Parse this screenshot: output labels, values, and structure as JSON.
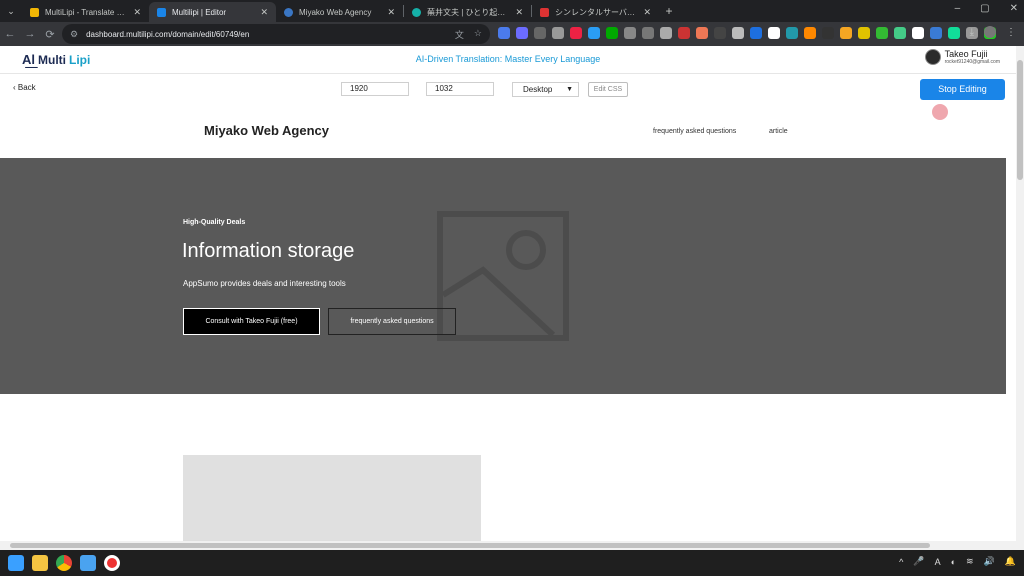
{
  "browser": {
    "tabs": [
      {
        "title": "MultiLipi - Translate websites h",
        "favicon_color": "#f2b705",
        "active": false
      },
      {
        "title": "Multilipi | Editor",
        "favicon_color": "#1a85e8",
        "active": true
      },
      {
        "title": "Miyako Web Agency",
        "favicon_color": "#3a76c4",
        "active": false
      },
      {
        "title": "蕪井文夫 | ひとり起業家専門のW",
        "favicon_color": "#15b0a8",
        "active": false
      },
      {
        "title": "シンレンタルサーバー サーバーパネル",
        "favicon_color": "#d33",
        "active": false
      }
    ],
    "new_tab": "+",
    "window_controls": [
      "–",
      "▢",
      "✕"
    ],
    "url": "dashboard.multilipi.com/domain/edit/60749/en",
    "nav": {
      "back": "←",
      "forward": "→",
      "reload": "⟳"
    },
    "extension_colors": [
      "#4b7bec",
      "#6c6cff",
      "#666",
      "#999",
      "#e24",
      "#2a9df4",
      "#0a0",
      "#888",
      "#777",
      "#aaa",
      "#c33",
      "#e75",
      "#444",
      "#bbb",
      "#1d6fe0",
      "#fff",
      "#29a",
      "#f80",
      "#333",
      "#f5a623",
      "#e0c200",
      "#3b3",
      "#4c8",
      "#fff",
      "#3a7bd5",
      "#1d9",
      "#999",
      "#2c2"
    ]
  },
  "multilipi": {
    "logo_prefix": "Multi",
    "logo_suffix": "Lipi",
    "tagline": "AI-Driven Translation: Master Every Language",
    "user_name": "Takeo Fujii",
    "user_email": "rocket91240@gmail.com"
  },
  "editor": {
    "back_label": "‹  Back",
    "width_value": "1920",
    "height_value": "1032",
    "device_value": "Desktop",
    "edit_css_label": "Edit CSS",
    "stop_editing_label": "Stop Editing"
  },
  "site": {
    "brand": "Miyako Web Agency",
    "nav_links": [
      "frequently asked questions",
      "article"
    ],
    "hero_kicker": "High-Quality Deals",
    "hero_title": "Information storage",
    "hero_subtitle": "AppSumo provides deals and interesting tools",
    "cta_primary": "Consult with Takeo Fujii (free)",
    "cta_secondary": "frequently asked questions"
  },
  "taskbar": {
    "apps": [
      "windows-start",
      "file-explorer",
      "chrome",
      "notepad",
      "recorder"
    ],
    "tray": [
      "^",
      "🎤",
      "A",
      "◐",
      "≋",
      "🔊",
      "🔔"
    ]
  }
}
